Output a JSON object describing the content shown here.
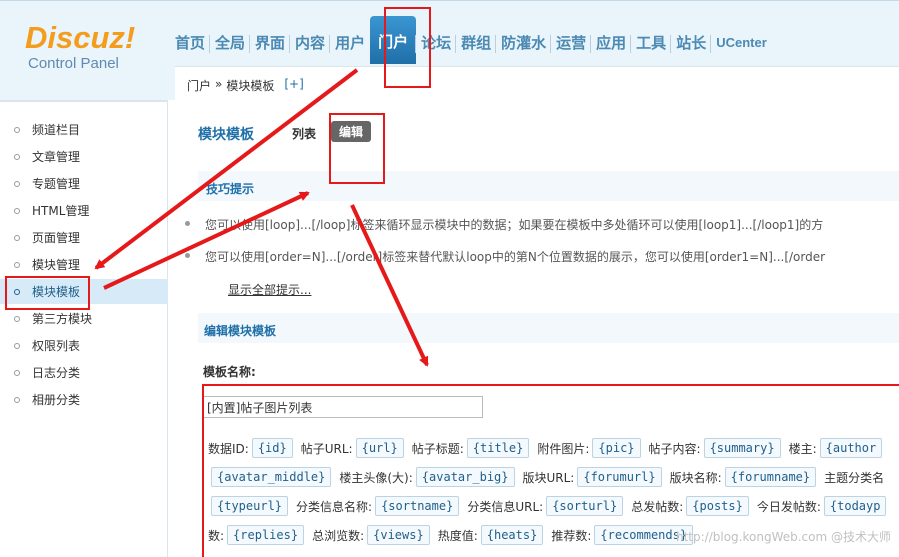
{
  "logo": {
    "name": "Discuz!",
    "subtitle": "Control Panel"
  },
  "nav": [
    "首页",
    "全局",
    "界面",
    "内容",
    "用户",
    "门户",
    "论坛",
    "群组",
    "防灌水",
    "运营",
    "应用",
    "工具",
    "站长",
    "UCenter"
  ],
  "nav_active": "门户",
  "breadcrumb": {
    "root": "门户",
    "sep": "»",
    "current": "模块模板",
    "add": "[+]"
  },
  "sidebar": [
    {
      "label": "频道栏目"
    },
    {
      "label": "文章管理"
    },
    {
      "label": "专题管理"
    },
    {
      "label": "HTML管理"
    },
    {
      "label": "页面管理"
    },
    {
      "label": "模块管理"
    },
    {
      "label": "模块模板",
      "active": true
    },
    {
      "label": "第三方模块"
    },
    {
      "label": "权限列表"
    },
    {
      "label": "日志分类"
    },
    {
      "label": "相册分类"
    }
  ],
  "main": {
    "title": "模块模板",
    "tab_list": "列表",
    "tab_edit": "编辑",
    "tips_title": "技巧提示",
    "tips": [
      "您可以使用[loop]...[/loop]标签来循环显示模块中的数据；如果要在模板中多处循环可以使用[loop1]...[/loop1]的方",
      "您可以使用[order=N]...[/order]标签来替代默认loop中的第N个位置数据的展示，您可以使用[order1=N]...[/order"
    ],
    "show_all": "显示全部提示...",
    "edit_title": "编辑模块模板",
    "name_label": "模板名称:",
    "name_value": "[内置]帖子图片列表"
  },
  "vars": [
    [
      {
        "label": "数据ID:",
        "tag": "{id}"
      },
      {
        "label": "帖子URL:",
        "tag": "{url}"
      },
      {
        "label": "帖子标题:",
        "tag": "{title}"
      },
      {
        "label": "附件图片:",
        "tag": "{pic}"
      },
      {
        "label": "帖子内容:",
        "tag": "{summary}"
      },
      {
        "label": "楼主:",
        "tag": "{author"
      }
    ],
    [
      {
        "label": "",
        "tag": "{avatar_middle}"
      },
      {
        "label": "楼主头像(大):",
        "tag": "{avatar_big}"
      },
      {
        "label": "版块URL:",
        "tag": "{forumurl}"
      },
      {
        "label": "版块名称:",
        "tag": "{forumname}"
      },
      {
        "label": "主题分类名",
        "tag": ""
      }
    ],
    [
      {
        "label": "",
        "tag": "{typeurl}"
      },
      {
        "label": "分类信息名称:",
        "tag": "{sortname}"
      },
      {
        "label": "分类信息URL:",
        "tag": "{sorturl}"
      },
      {
        "label": "总发帖数:",
        "tag": "{posts}"
      },
      {
        "label": "今日发帖数:",
        "tag": "{todayp"
      }
    ],
    [
      {
        "label": "数:",
        "tag": "{replies}"
      },
      {
        "label": "总浏览数:",
        "tag": "{views}"
      },
      {
        "label": "热度值:",
        "tag": "{heats}"
      },
      {
        "label": "推荐数:",
        "tag": "{recommends}"
      }
    ]
  ],
  "watermark": "http://blog.kongWeb.com @技术大师",
  "colors": {
    "highlight": "#e5191a",
    "nav_text": "#4b8ab3",
    "nav_active_bg": "#2b82bd",
    "logo_orange": "#f49d1c"
  }
}
